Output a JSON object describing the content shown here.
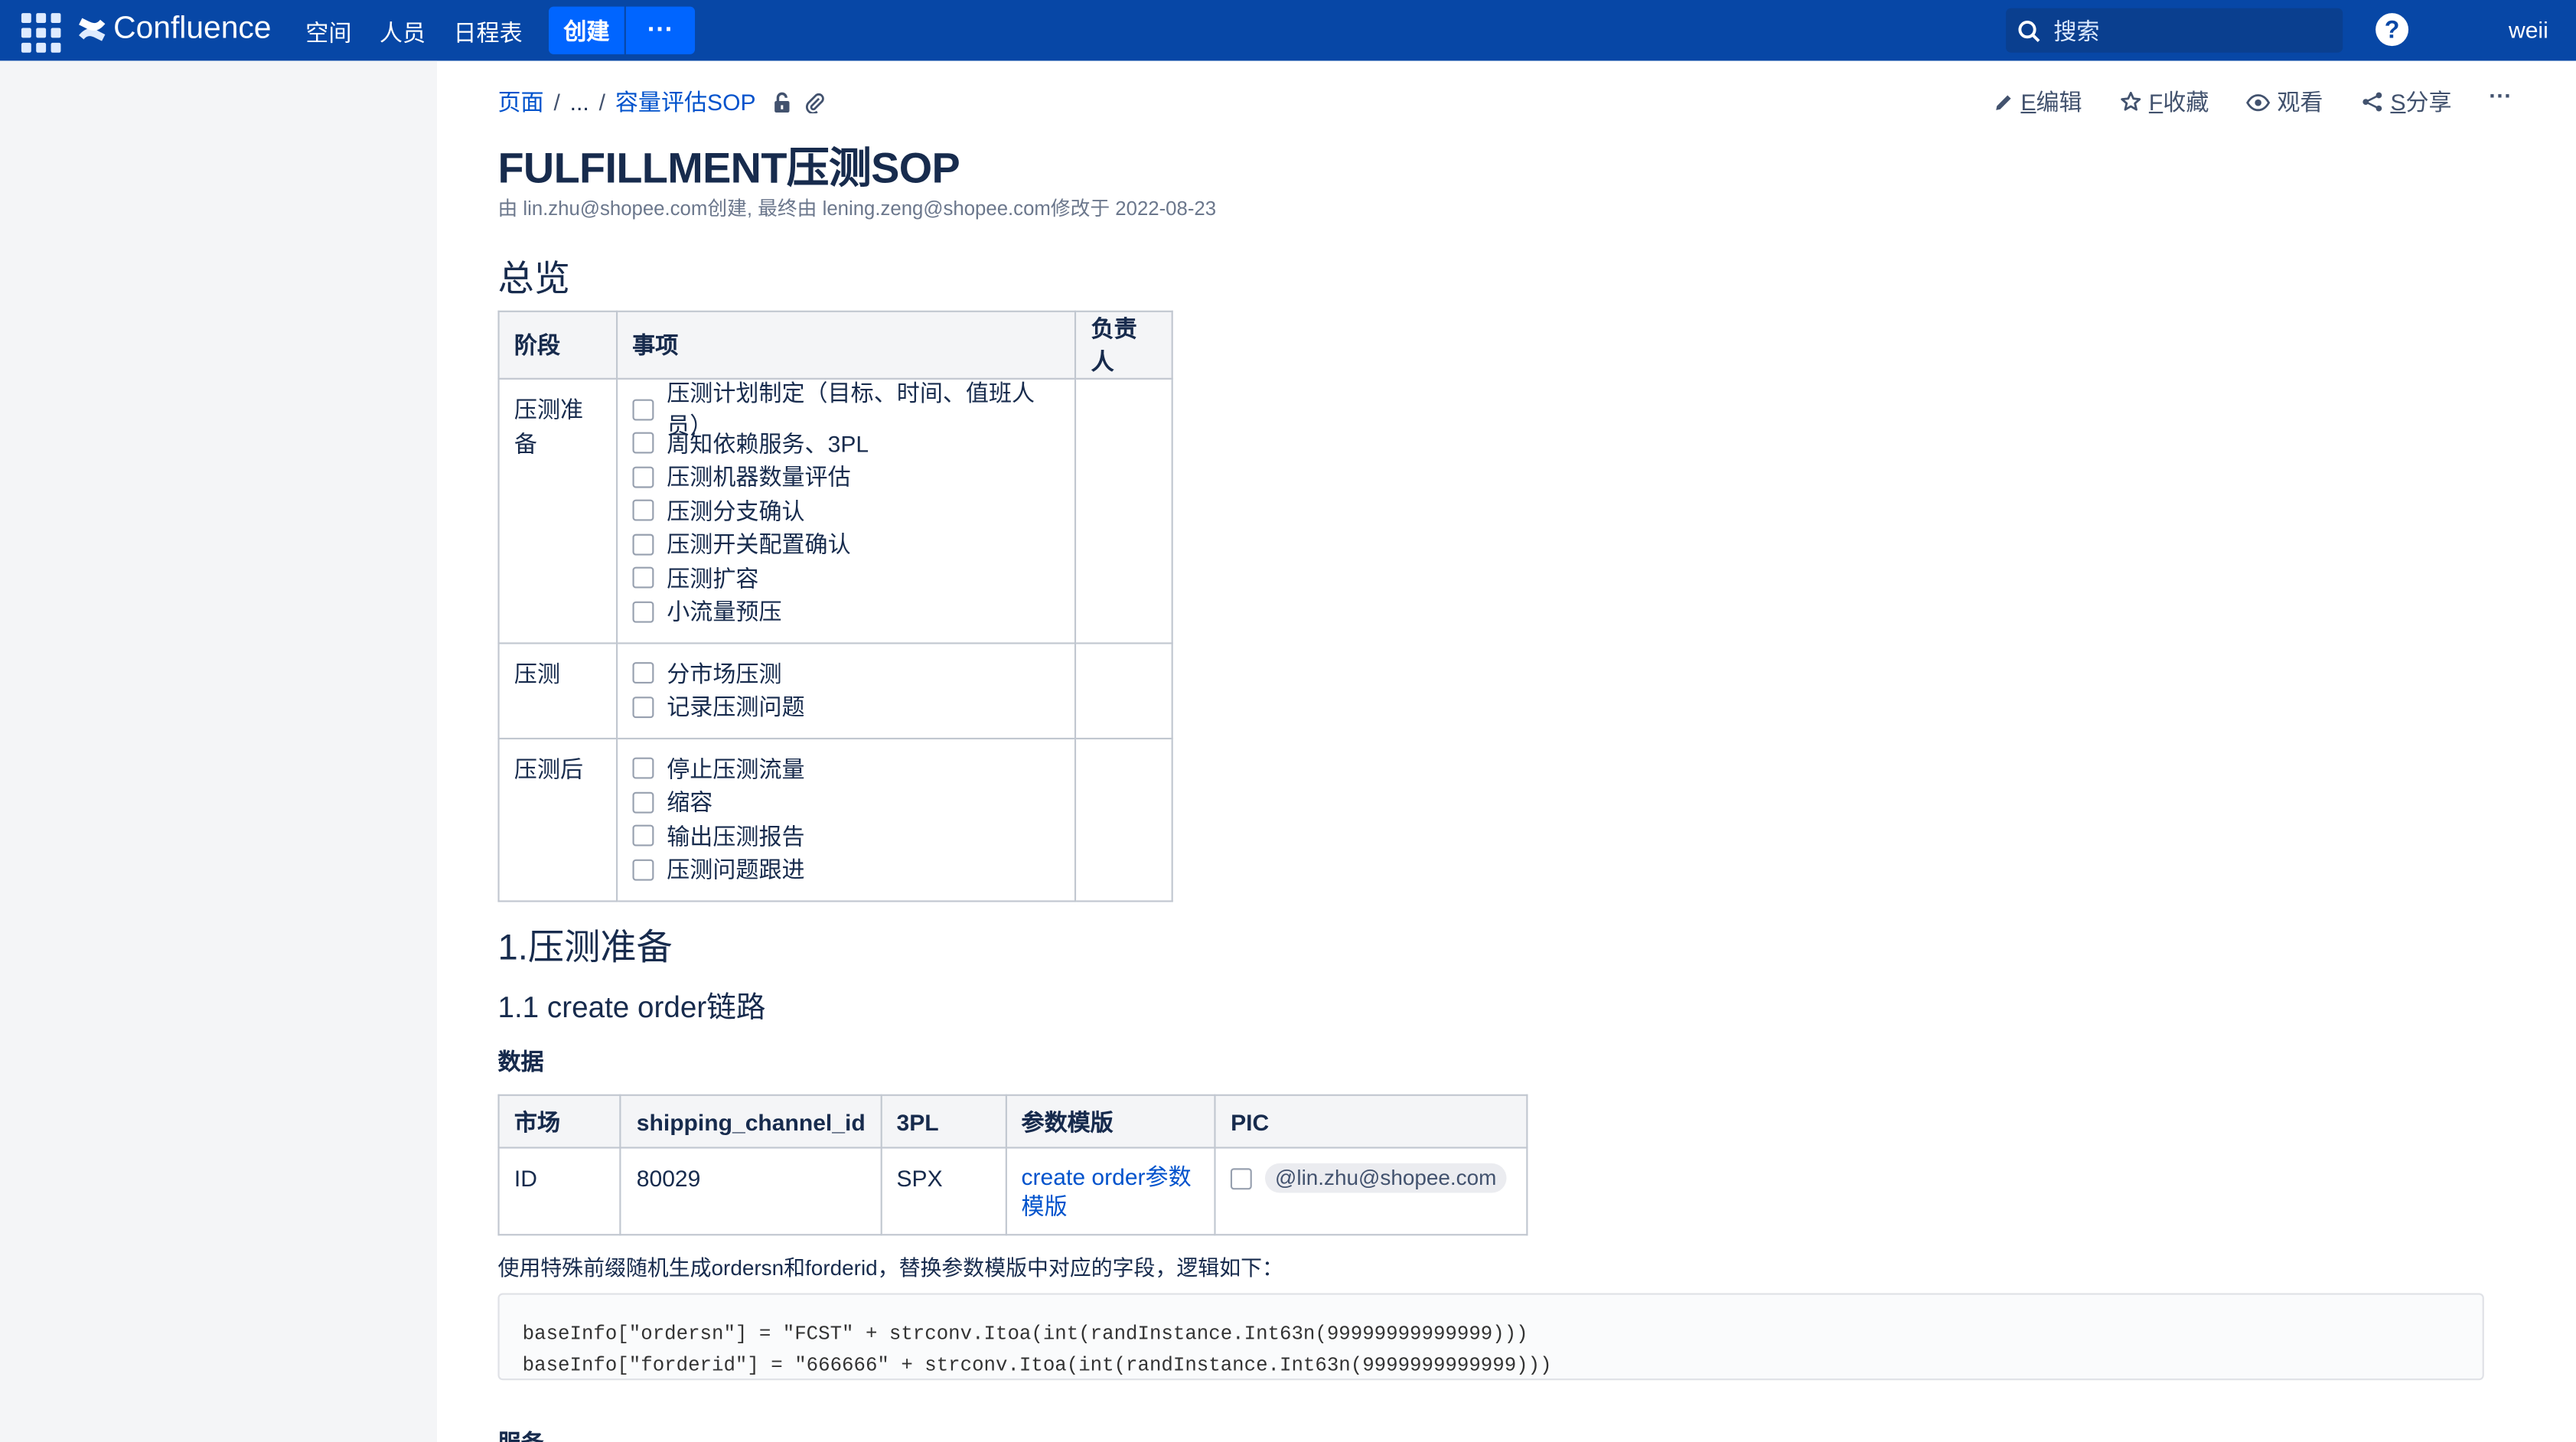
{
  "topbar": {
    "product": "Confluence",
    "nav": [
      "空间",
      "人员",
      "日程表"
    ],
    "create_label": "创建",
    "more_label": "···",
    "search_placeholder": "搜索",
    "help_label": "?",
    "user": "weii"
  },
  "breadcrumb": {
    "root": "页面",
    "ellipsis": "...",
    "parent": "容量评估SOP"
  },
  "actions": {
    "edit_key": "E",
    "edit": "编辑",
    "favorite_key": "F",
    "favorite": "收藏",
    "watch": "观看",
    "share_key": "S",
    "share": "分享",
    "more": "···"
  },
  "page": {
    "title": "FULFILLMENT压测SOP",
    "byline": "由 lin.zhu@shopee.com创建, 最终由 lening.zeng@shopee.com修改于 2022-08-23"
  },
  "overview": {
    "heading": "总览",
    "headers": [
      "阶段",
      "事项",
      "负责人"
    ],
    "rows": [
      {
        "stage": "压测准备",
        "tasks": [
          "压测计划制定（目标、时间、值班人员）",
          "周知依赖服务、3PL",
          "压测机器数量评估",
          "压测分支确认",
          "压测开关配置确认",
          "压测扩容",
          "小流量预压"
        ],
        "owner": ""
      },
      {
        "stage": "压测",
        "tasks": [
          "分市场压测",
          "记录压测问题"
        ],
        "owner": ""
      },
      {
        "stage": "压测后",
        "tasks": [
          "停止压测流量",
          "缩容",
          "输出压测报告",
          "压测问题跟进"
        ],
        "owner": ""
      }
    ]
  },
  "prep": {
    "heading": "1.压测准备",
    "subheading": "1.1 create order链路",
    "data_heading": "数据",
    "table": {
      "headers": [
        "市场",
        "shipping_channel_id",
        "3PL",
        "参数模版",
        "PIC"
      ],
      "row": {
        "market": "ID",
        "channel_id": "80029",
        "tpl": "SPX",
        "template_link": "create order参数模版",
        "pic": "@lin.zhu@shopee.com"
      }
    },
    "note": "使用特殊前缀随机生成ordersn和forderid，替换参数模版中对应的字段，逻辑如下：",
    "code_lines": [
      "baseInfo[\"ordersn\"] = \"FCST\" + strconv.Itoa(int(randInstance.Int63n(99999999999999)))",
      "baseInfo[\"forderid\"] = \"666666\" + strconv.Itoa(int(randInstance.Int63n(9999999999999)))"
    ],
    "service_heading": "服务"
  }
}
